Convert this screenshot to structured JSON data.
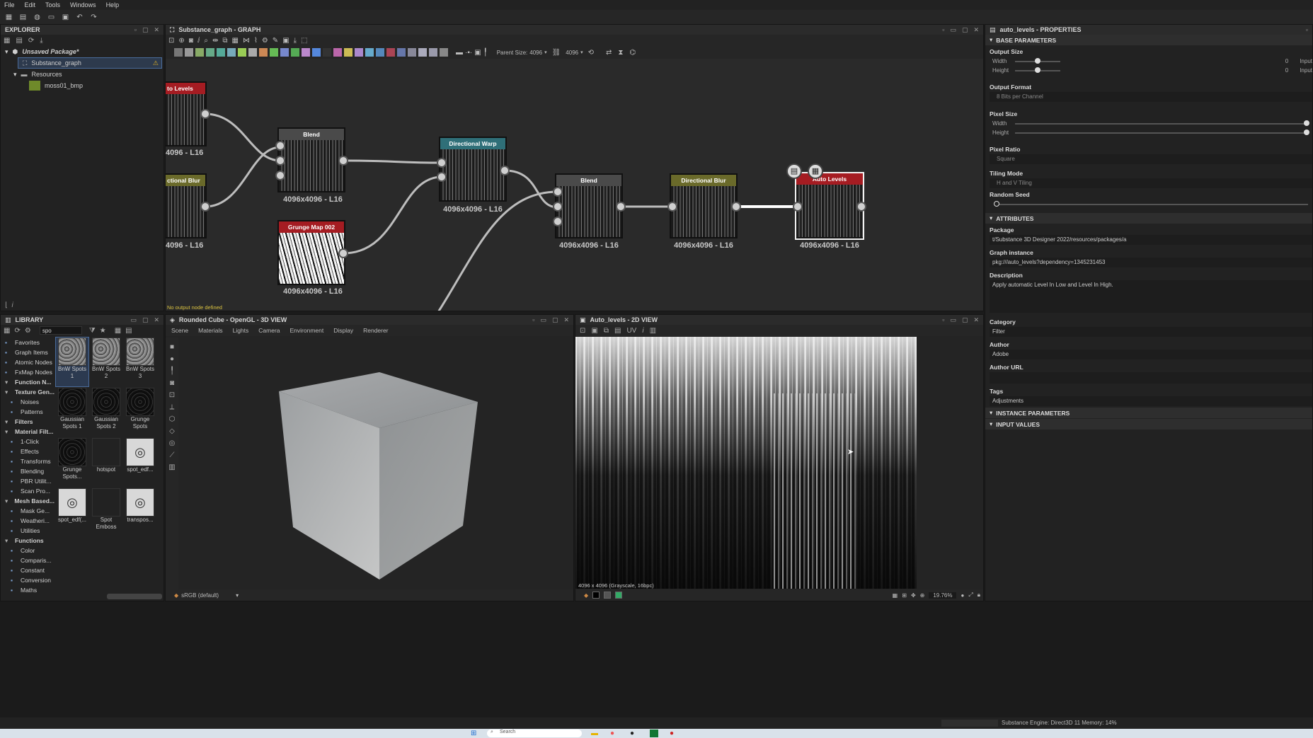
{
  "menu": [
    "File",
    "Edit",
    "Tools",
    "Windows",
    "Help"
  ],
  "explorer": {
    "title": "EXPLORER",
    "package": "Unsaved Package*",
    "graph": "Substance_graph",
    "resources": "Resources",
    "resource_item": "moss01_bmp"
  },
  "graph_panel": {
    "title": "Substance_graph - GRAPH",
    "parent_size_label": "Parent Size:",
    "parent_size_value": "4096",
    "size_value": "4096",
    "status": "No output node defined",
    "nodes": [
      {
        "name": "node-auto-levels-left",
        "title": "to Levels",
        "label": "4096 - L16",
        "color": "#a51c22"
      },
      {
        "name": "node-directional-blur-left",
        "title": "ctional Blur",
        "label": "4096 - L16",
        "color": "#6a6a2a"
      },
      {
        "name": "node-blend-1",
        "title": "Blend",
        "label": "4096x4096 - L16",
        "color": "#4a4a4a"
      },
      {
        "name": "node-grunge-map",
        "title": "Grunge Map 002",
        "label": "4096x4096 - L16",
        "color": "#a51c22"
      },
      {
        "name": "node-directional-warp",
        "title": "Directional Warp",
        "label": "4096x4096 - L16",
        "color": "#2f6f78"
      },
      {
        "name": "node-blend-2",
        "title": "Blend",
        "label": "4096x4096 - L16",
        "color": "#4a4a4a"
      },
      {
        "name": "node-directional-blur",
        "title": "Directional Blur",
        "label": "4096x4096 - L16",
        "color": "#6a6a2a"
      },
      {
        "name": "node-auto-levels",
        "title": "Auto Levels",
        "label": "4096x4096 - L16",
        "color": "#a51c22"
      }
    ]
  },
  "library": {
    "title": "LIBRARY",
    "search": "spo",
    "categories": [
      {
        "label": "Favorites",
        "bold": false
      },
      {
        "label": "Graph Items",
        "bold": false
      },
      {
        "label": "Atomic Nodes",
        "bold": false
      },
      {
        "label": "FxMap Nodes",
        "bold": false
      },
      {
        "label": "Function N...",
        "bold": true
      },
      {
        "label": "Texture Gen...",
        "bold": true
      },
      {
        "label": "Noises",
        "bold": false
      },
      {
        "label": "Patterns",
        "bold": false
      },
      {
        "label": "Filters",
        "bold": true
      },
      {
        "label": "Material Filt...",
        "bold": true
      },
      {
        "label": "1-Click",
        "bold": false
      },
      {
        "label": "Effects",
        "bold": false
      },
      {
        "label": "Transforms",
        "bold": false
      },
      {
        "label": "Blending",
        "bold": false
      },
      {
        "label": "PBR Utilit...",
        "bold": false
      },
      {
        "label": "Scan Pro...",
        "bold": false
      },
      {
        "label": "Mesh Based...",
        "bold": true
      },
      {
        "label": "Mask Ge...",
        "bold": false
      },
      {
        "label": "Weatheri...",
        "bold": false
      },
      {
        "label": "Utilities",
        "bold": false
      },
      {
        "label": "Functions",
        "bold": true
      },
      {
        "label": "Color",
        "bold": false
      },
      {
        "label": "Comparis...",
        "bold": false
      },
      {
        "label": "Constant",
        "bold": false
      },
      {
        "label": "Conversion",
        "bold": false
      },
      {
        "label": "Maths",
        "bold": false
      }
    ],
    "items": [
      {
        "label": "BnW Spots 1",
        "style": "noise"
      },
      {
        "label": "BnW Spots 2",
        "style": "noise"
      },
      {
        "label": "BnW Spots 3",
        "style": "noise"
      },
      {
        "label": "Gaussian Spots 1",
        "style": "dark"
      },
      {
        "label": "Gaussian Spots 2",
        "style": "dark"
      },
      {
        "label": "Grunge Spots",
        "style": "dark"
      },
      {
        "label": "Grunge Spots...",
        "style": "dark"
      },
      {
        "label": "hotspot",
        "style": "blank"
      },
      {
        "label": "spot_edf...",
        "style": "icon"
      },
      {
        "label": "spot_edf(...",
        "style": "icon"
      },
      {
        "label": "Spot Emboss",
        "style": "blank"
      },
      {
        "label": "transpos...",
        "style": "icon"
      }
    ]
  },
  "view3d": {
    "title": "Rounded Cube - OpenGL - 3D VIEW",
    "tabs": [
      "Scene",
      "Materials",
      "Lights",
      "Camera",
      "Environment",
      "Display",
      "Renderer"
    ],
    "colorspace": "sRGB (default)"
  },
  "view2d": {
    "title": "Auto_levels - 2D VIEW",
    "info": "4096 x 4096 (Grayscale, 16bpc)",
    "zoom": "19.76%"
  },
  "properties": {
    "title": "auto_levels - PROPERTIES",
    "base_parameters": "BASE PARAMETERS",
    "output_size": "Output Size",
    "width": "Width",
    "height": "Height",
    "width_val": "0",
    "height_val": "0",
    "input_lbl": "Input",
    "output_format": "Output Format",
    "output_format_val": "8 Bits per Channel",
    "pixel_size": "Pixel Size",
    "pixel_ratio": "Pixel Ratio",
    "pixel_ratio_val": "Square",
    "tiling_mode": "Tiling Mode",
    "tiling_mode_val": "H and V Tiling",
    "random_seed": "Random Seed",
    "attributes": "ATTRIBUTES",
    "package": "Package",
    "package_val": "t/Substance 3D Designer 2022/resources/packages/a",
    "graph_instance": "Graph instance",
    "graph_instance_val": "pkg:///auto_levels?dependency=1345231453",
    "description": "Description",
    "description_val": "Apply automatic Level In Low and Level In High.",
    "category": "Category",
    "category_val": "Filter",
    "author": "Author",
    "author_val": "Adobe",
    "author_url": "Author URL",
    "tags": "Tags",
    "tags_val": "Adjustments",
    "instance_parameters": "INSTANCE PARAMETERS",
    "input_values": "INPUT VALUES"
  },
  "status": {
    "engine": "Substance Engine: Direct3D 11  Memory: 14%"
  },
  "taskbar": {
    "search": "Search"
  }
}
